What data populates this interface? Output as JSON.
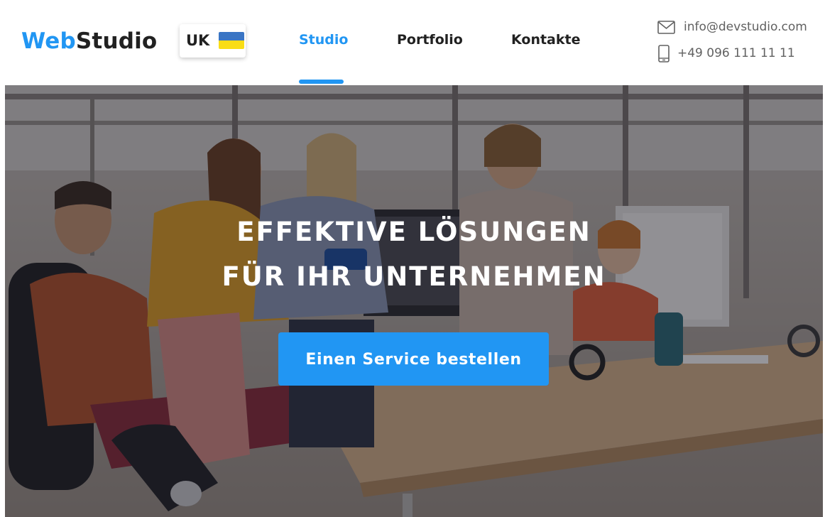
{
  "header": {
    "logo": {
      "part1": "Web",
      "part2": "Studio"
    },
    "language": {
      "code": "UK",
      "flag_icon": "ukraine-flag-icon",
      "flag_colors": [
        "#3a75c4",
        "#f9dd16"
      ]
    },
    "nav": [
      {
        "label": "Studio",
        "active": true
      },
      {
        "label": "Portfolio",
        "active": false
      },
      {
        "label": "Kontakte",
        "active": false
      }
    ],
    "contacts": {
      "email": "info@devstudio.com",
      "email_icon": "envelope-icon",
      "phone": "+49 096 111 11 11",
      "phone_icon": "mobile-phone-icon"
    }
  },
  "hero": {
    "title_line1": "EFFEKTIVE LÖSUNGEN",
    "title_line2": "FÜR IHR UNTERNEHMEN",
    "cta_label": "Einen Service bestellen"
  },
  "colors": {
    "accent": "#2196f3",
    "text_dark": "#212121",
    "text_muted": "#616161"
  }
}
